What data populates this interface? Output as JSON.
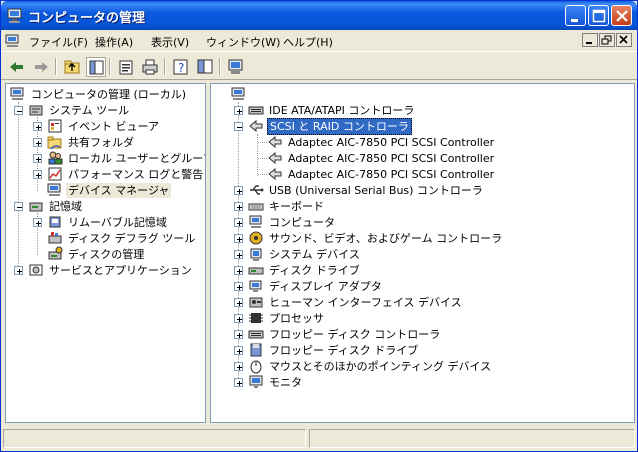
{
  "window": {
    "title": "コンピュータの管理"
  },
  "menubar": {
    "items": [
      "ファイル(F)",
      "操作(A)",
      "表示(V)",
      "ウィンドウ(W)",
      "ヘルプ(H)"
    ]
  },
  "toolbar": {
    "buttons": [
      "back-arrow-icon",
      "forward-arrow-icon",
      "up-folder-icon",
      "show-hide-tree-icon",
      "properties-icon",
      "print-icon",
      "help-icon",
      "action-pane-icon",
      "scan-hardware-icon"
    ]
  },
  "left_tree": [
    {
      "label": "コンピュータの管理 (ローカル)"
    },
    {
      "label": "システム ツール"
    },
    {
      "label": "イベント ビューア"
    },
    {
      "label": "共有フォルダ"
    },
    {
      "label": "ローカル ユーザーとグループ"
    },
    {
      "label": "パフォーマンス ログと警告"
    },
    {
      "label": "デバイス マネージャ"
    },
    {
      "label": "記憶域"
    },
    {
      "label": "リムーバブル記憶域"
    },
    {
      "label": "ディスク デフラグ ツール"
    },
    {
      "label": "ディスクの管理"
    },
    {
      "label": "サービスとアプリケーション"
    }
  ],
  "right_tree": [
    {
      "label": "IDE ATA/ATAPI コントローラ"
    },
    {
      "label": "SCSI と RAID コントローラ"
    },
    {
      "label": "Adaptec AIC-7850 PCI SCSI Controller"
    },
    {
      "label": "Adaptec AIC-7850 PCI SCSI Controller"
    },
    {
      "label": "Adaptec AIC-7850 PCI SCSI Controller"
    },
    {
      "label": "USB (Universal Serial Bus) コントローラ"
    },
    {
      "label": "キーボード"
    },
    {
      "label": "コンピュータ"
    },
    {
      "label": "サウンド、ビデオ、およびゲーム コントローラ"
    },
    {
      "label": "システム デバイス"
    },
    {
      "label": "ディスク ドライブ"
    },
    {
      "label": "ディスプレイ アダプタ"
    },
    {
      "label": "ヒューマン インターフェイス デバイス"
    },
    {
      "label": "プロセッサ"
    },
    {
      "label": "フロッピー ディスク コントローラ"
    },
    {
      "label": "フロッピー ディスク ドライブ"
    },
    {
      "label": "マウスとそのほかのポインティング デバイス"
    },
    {
      "label": "モニタ"
    }
  ],
  "colors": {
    "titlebar": "#0054e3",
    "selection": "#316ac5",
    "face": "#ece9d8"
  }
}
